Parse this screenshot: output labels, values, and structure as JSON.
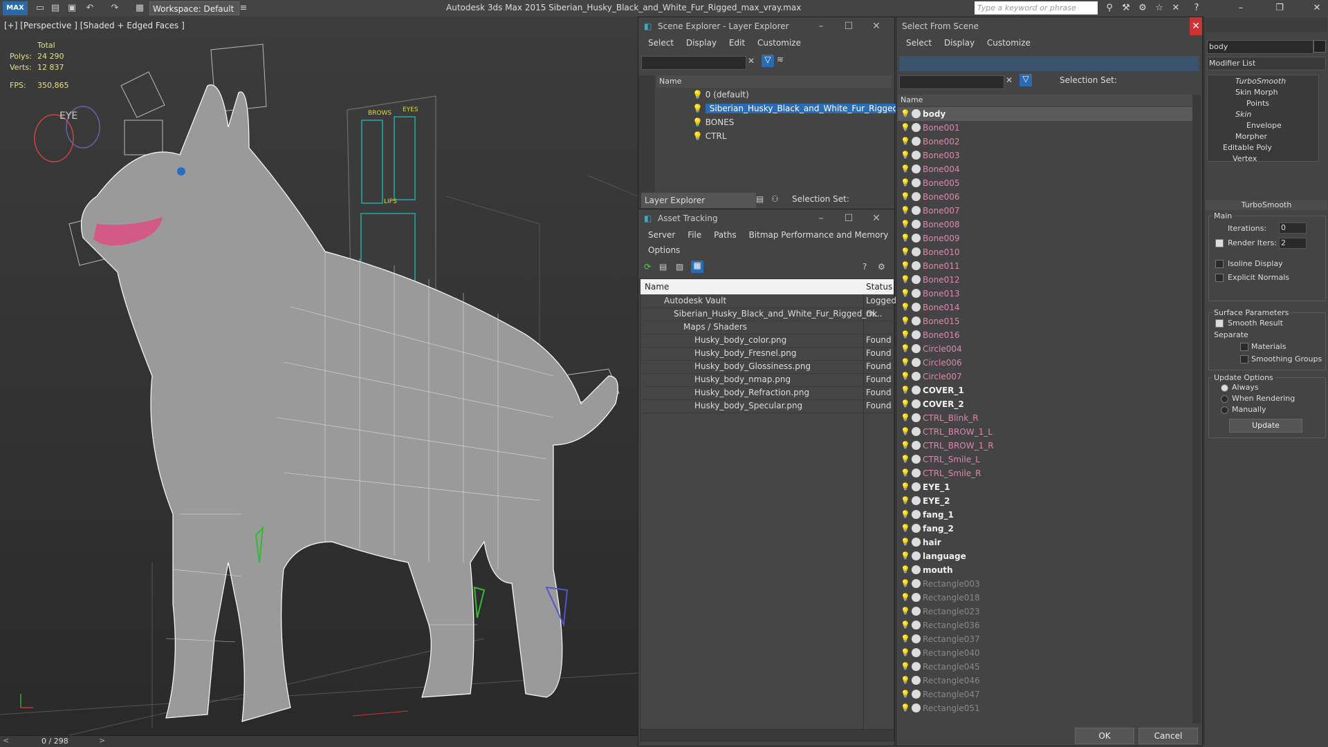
{
  "app": {
    "logo": "MAX",
    "workspace": "Workspace: Default",
    "title": "Autodesk 3ds Max  2015    Siberian_Husky_Black_and_White_Fur_Rigged_max_vray.max",
    "search_placeholder": "Type a keyword or phrase"
  },
  "viewport": {
    "label": "[+] [Perspective ] [Shaded + Edged Faces ]",
    "stats": {
      "total_label": "Total",
      "polys_label": "Polys:",
      "polys": "24 290",
      "verts_label": "Verts:",
      "verts": "12 837",
      "fps_label": "FPS:",
      "fps": "350,865"
    },
    "panel_labels": {
      "brows": "BROWS",
      "eyes": "EYES",
      "lips": "LIPS",
      "eye": "EYE"
    },
    "timeline": "0 / 298"
  },
  "scene_explorer": {
    "title": "Scene Explorer - Layer Explorer",
    "menus": [
      "Select",
      "Display",
      "Edit",
      "Customize"
    ],
    "column": "Name",
    "layers": [
      "0 (default)",
      "Siberian_Husky_Black_and_White_Fur_Rigged",
      "BONES",
      "CTRL"
    ],
    "footer_dropdown": "Layer Explorer",
    "selection_set_label": "Selection Set:"
  },
  "asset_tracking": {
    "title": "Asset Tracking",
    "menus": [
      "Server",
      "File",
      "Paths",
      "Bitmap Performance and Memory"
    ],
    "menu2": "Options",
    "col_name": "Name",
    "col_status": "Status",
    "rows": [
      {
        "name": "Autodesk Vault",
        "status": "Logged"
      },
      {
        "name": "Siberian_Husky_Black_and_White_Fur_Rigged_m...",
        "status": "Ok"
      },
      {
        "name": "Maps / Shaders",
        "status": ""
      },
      {
        "name": "Husky_body_color.png",
        "status": "Found"
      },
      {
        "name": "Husky_body_Fresnel.png",
        "status": "Found"
      },
      {
        "name": "Husky_body_Glossiness.png",
        "status": "Found"
      },
      {
        "name": "Husky_body_nmap.png",
        "status": "Found"
      },
      {
        "name": "Husky_body_Refraction.png",
        "status": "Found"
      },
      {
        "name": "Husky_body_Specular.png",
        "status": "Found"
      }
    ]
  },
  "select_from_scene": {
    "title": "Select From Scene",
    "menus": [
      "Select",
      "Display",
      "Customize"
    ],
    "selection_set_label": "Selection Set:",
    "column": "Name",
    "items": [
      {
        "name": "body",
        "style": "bold",
        "icon": "sphere"
      },
      {
        "name": "Bone001",
        "style": "pink",
        "icon": "bone"
      },
      {
        "name": "Bone002",
        "style": "pink",
        "icon": "bone"
      },
      {
        "name": "Bone003",
        "style": "pink",
        "icon": "bone"
      },
      {
        "name": "Bone004",
        "style": "pink",
        "icon": "bone"
      },
      {
        "name": "Bone005",
        "style": "pink",
        "icon": "bone"
      },
      {
        "name": "Bone006",
        "style": "pink",
        "icon": "bone"
      },
      {
        "name": "Bone007",
        "style": "pink",
        "icon": "bone"
      },
      {
        "name": "Bone008",
        "style": "pink",
        "icon": "bone"
      },
      {
        "name": "Bone009",
        "style": "pink",
        "icon": "bone"
      },
      {
        "name": "Bone010",
        "style": "pink",
        "icon": "bone"
      },
      {
        "name": "Bone011",
        "style": "pink",
        "icon": "bone"
      },
      {
        "name": "Bone012",
        "style": "pink",
        "icon": "bone"
      },
      {
        "name": "Bone013",
        "style": "pink",
        "icon": "bone"
      },
      {
        "name": "Bone014",
        "style": "pink",
        "icon": "bone"
      },
      {
        "name": "Bone015",
        "style": "pink",
        "icon": "bone"
      },
      {
        "name": "Bone016",
        "style": "pink",
        "icon": "bone"
      },
      {
        "name": "Circle004",
        "style": "pink",
        "icon": "shape"
      },
      {
        "name": "Circle006",
        "style": "pink",
        "icon": "shape"
      },
      {
        "name": "Circle007",
        "style": "pink",
        "icon": "shape"
      },
      {
        "name": "COVER_1",
        "style": "bold",
        "icon": "sphere"
      },
      {
        "name": "COVER_2",
        "style": "bold",
        "icon": "sphere"
      },
      {
        "name": "CTRL_Blink_R",
        "style": "pink",
        "icon": "shape"
      },
      {
        "name": "CTRL_BROW_1_L",
        "style": "pink",
        "icon": "shape"
      },
      {
        "name": "CTRL_BROW_1_R",
        "style": "pink",
        "icon": "shape"
      },
      {
        "name": "CTRL_Smile_L",
        "style": "pink",
        "icon": "shape"
      },
      {
        "name": "CTRL_Smile_R",
        "style": "pink",
        "icon": "shape"
      },
      {
        "name": "EYE_1",
        "style": "bold",
        "icon": "sphere"
      },
      {
        "name": "EYE_2",
        "style": "bold",
        "icon": "sphere"
      },
      {
        "name": "fang_1",
        "style": "bold",
        "icon": "sphere"
      },
      {
        "name": "fang_2",
        "style": "bold",
        "icon": "sphere"
      },
      {
        "name": "hair",
        "style": "bold",
        "icon": "sphere"
      },
      {
        "name": "language",
        "style": "bold",
        "icon": "sphere"
      },
      {
        "name": "mouth",
        "style": "bold",
        "icon": "sphere"
      },
      {
        "name": "Rectangle003",
        "style": "grey",
        "icon": "shape"
      },
      {
        "name": "Rectangle018",
        "style": "grey",
        "icon": "shape"
      },
      {
        "name": "Rectangle023",
        "style": "grey",
        "icon": "shape"
      },
      {
        "name": "Rectangle036",
        "style": "grey",
        "icon": "shape"
      },
      {
        "name": "Rectangle037",
        "style": "grey",
        "icon": "shape"
      },
      {
        "name": "Rectangle040",
        "style": "grey",
        "icon": "shape"
      },
      {
        "name": "Rectangle045",
        "style": "grey",
        "icon": "shape"
      },
      {
        "name": "Rectangle046",
        "style": "grey",
        "icon": "shape"
      },
      {
        "name": "Rectangle047",
        "style": "grey",
        "icon": "shape"
      },
      {
        "name": "Rectangle051",
        "style": "grey",
        "icon": "shape"
      }
    ],
    "ok": "OK",
    "cancel": "Cancel"
  },
  "command_panel": {
    "object_name": "body",
    "modifier_list": "Modifier List",
    "stack": [
      "TurboSmooth",
      "Skin Morph",
      "Points",
      "Skin",
      "Envelope",
      "Morpher",
      "Editable Poly",
      "Vertex"
    ],
    "rollout_title": "TurboSmooth",
    "main_group": "Main",
    "iterations_label": "Iterations:",
    "iterations_value": "0",
    "render_iters_label": "Render Iters:",
    "render_iters_value": "2",
    "isoline": "Isoline Display",
    "explicit_normals": "Explicit Normals",
    "surface_group": "Surface Parameters",
    "smooth_result": "Smooth Result",
    "separate": "Separate",
    "materials": "Materials",
    "smoothing_groups": "Smoothing Groups",
    "update_group": "Update Options",
    "always": "Always",
    "when_rendering": "When Rendering",
    "manually": "Manually",
    "update_btn": "Update"
  },
  "colors": {
    "selection": "#2a6cb4",
    "bone_text": "#d78ab0",
    "bulb": "#e8d84a"
  }
}
